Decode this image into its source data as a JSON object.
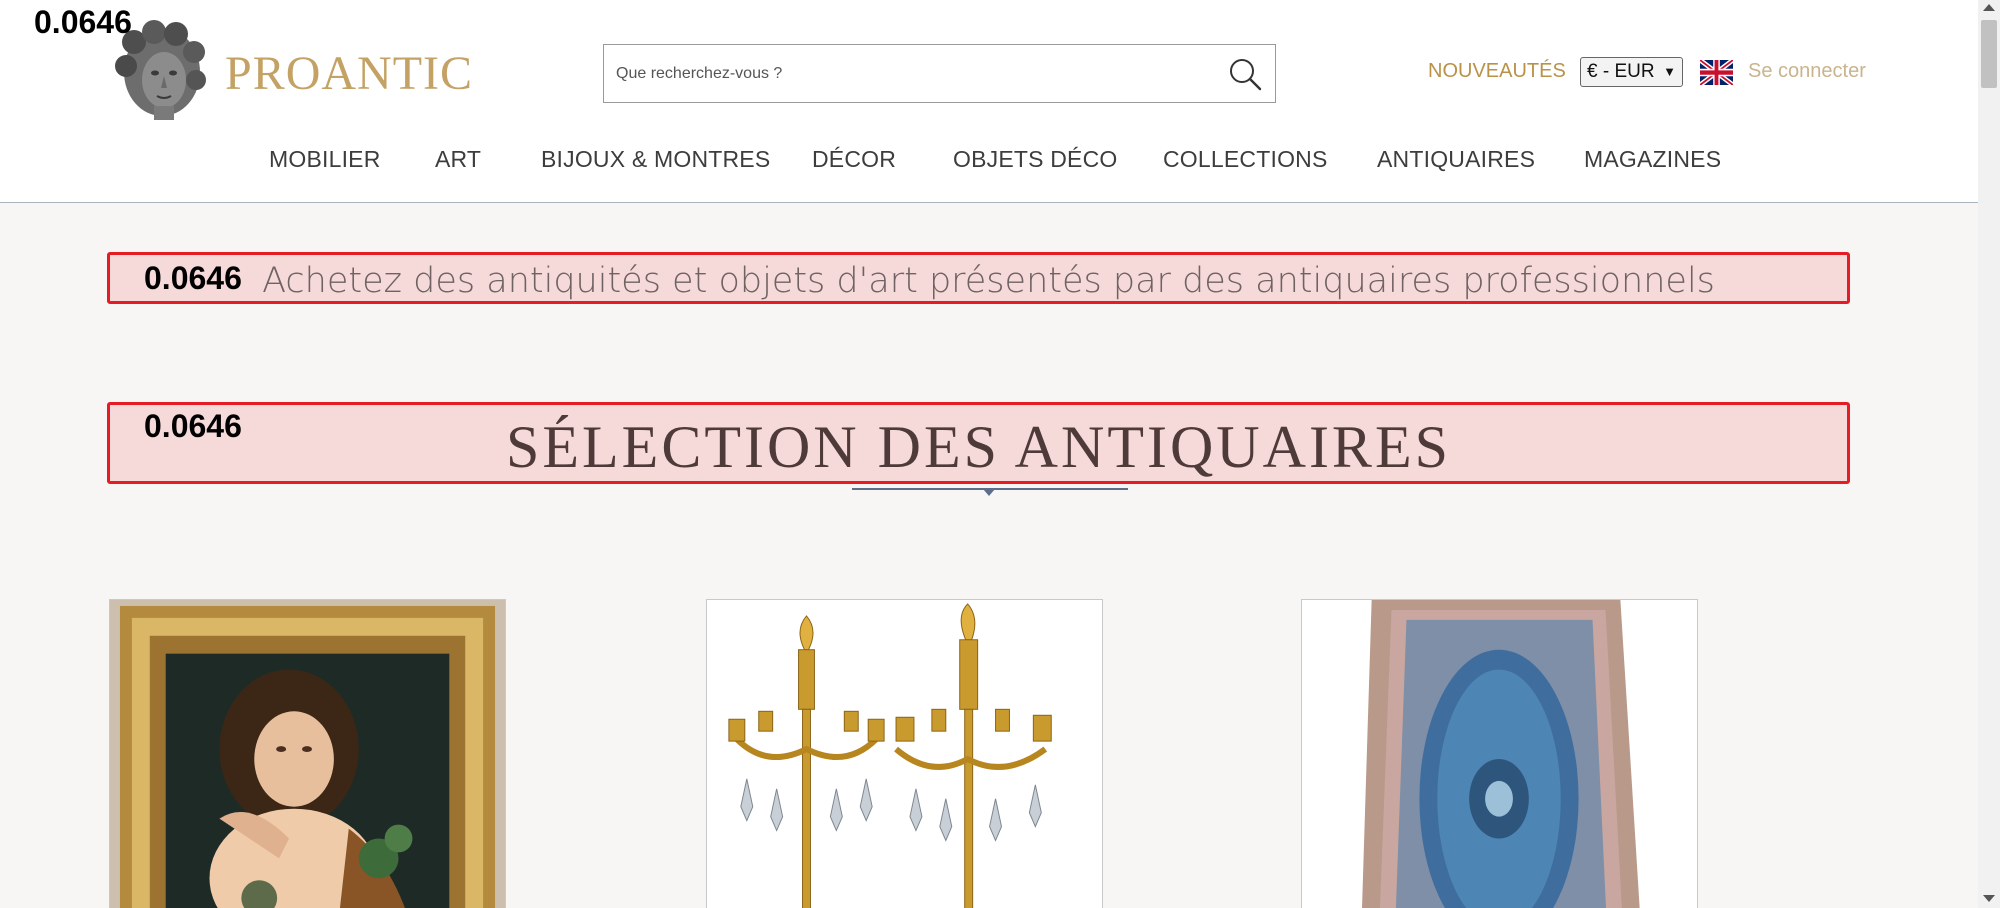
{
  "score": "0.0646",
  "brand": {
    "name": "PROANTIC",
    "logo_icon": "sculpted-head-logo-icon"
  },
  "search": {
    "placeholder": "Que recherchez-vous ?",
    "icon": "search-icon"
  },
  "header_links": {
    "new_label": "NOUVEAUTÉS",
    "login_label": "Se connecter"
  },
  "currency": {
    "selected": "€ - EUR"
  },
  "language": {
    "icon": "uk-flag-icon"
  },
  "nav": {
    "items": [
      {
        "label": "MOBILIER"
      },
      {
        "label": "ART"
      },
      {
        "label": "BIJOUX & MONTRES"
      },
      {
        "label": "DÉCOR"
      },
      {
        "label": "OBJETS DÉCO"
      },
      {
        "label": "COLLECTIONS"
      },
      {
        "label": "ANTIQUAIRES"
      },
      {
        "label": "MAGAZINES"
      }
    ]
  },
  "tagline": "Achetez des antiquités et objets d'art présentés par des antiquaires professionnels",
  "section_title": "SÉLECTION DES ANTIQUAIRES",
  "colors": {
    "brand": "#c4a265",
    "new_link": "#b99248",
    "login_link": "#c9b48e",
    "highlight_border": "#e51c23",
    "highlight_fill": "#f6d9d9"
  },
  "products": [
    {
      "image": "framed-portrait-painting"
    },
    {
      "image": "gilt-bronze-candelabra-pair"
    },
    {
      "image": "blue-oriental-rug"
    }
  ]
}
